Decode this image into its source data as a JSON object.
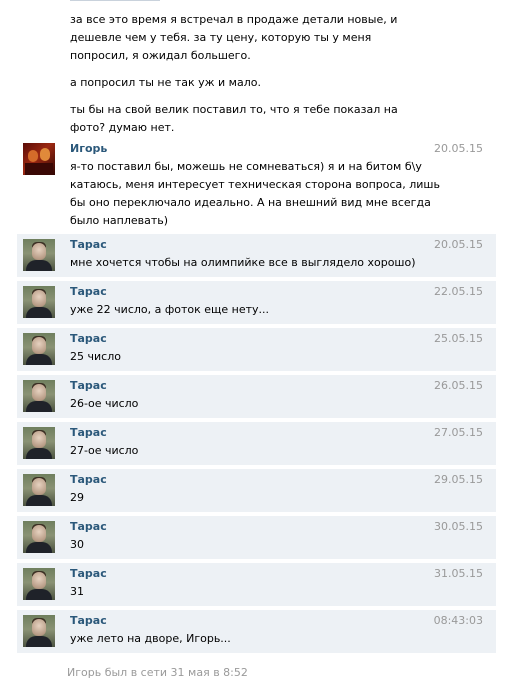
{
  "intro_paragraphs": [
    "за все это время я встречал в продаже детали новые, и дешевле чем у тебя. за ту цену, которую ты у меня попросил, я ожидал большего.",
    "а попросил ты не так уж и мало.",
    "ты бы на свой велик поставил то, что я тебе показал на фото? думаю нет."
  ],
  "messages": [
    {
      "author": "Игорь",
      "date": "20.05.15",
      "text": "я-то поставил бы, можешь не сомневаться) я и на битом б\\у катаюсь, меня интересует техническая сторона вопроса, лишь бы оно переключало идеально. А на внешний вид мне всегда было наплевать)"
    },
    {
      "author": "Тарас",
      "date": "20.05.15",
      "text": "мне хочется чтобы на олимпийке все в выглядело хорошо)"
    },
    {
      "author": "Тарас",
      "date": "22.05.15",
      "text": "уже 22 число, а фоток еще нету..."
    },
    {
      "author": "Тарас",
      "date": "25.05.15",
      "text": "25 число"
    },
    {
      "author": "Тарас",
      "date": "26.05.15",
      "text": "26-ое число"
    },
    {
      "author": "Тарас",
      "date": "27.05.15",
      "text": "27-ое число"
    },
    {
      "author": "Тарас",
      "date": "29.05.15",
      "text": "29"
    },
    {
      "author": "Тарас",
      "date": "30.05.15",
      "text": "30"
    },
    {
      "author": "Тарас",
      "date": "31.05.15",
      "text": "31"
    },
    {
      "author": "Тарас",
      "date": "08:43:03",
      "text": "уже лето на дворе, Игорь..."
    }
  ],
  "footer": {
    "last_seen": "Игорь был в сети 31 мая в 8:52"
  },
  "colors": {
    "author_link": "#2b587a",
    "unread_bg": "#edf1f5",
    "date": "#999999"
  }
}
